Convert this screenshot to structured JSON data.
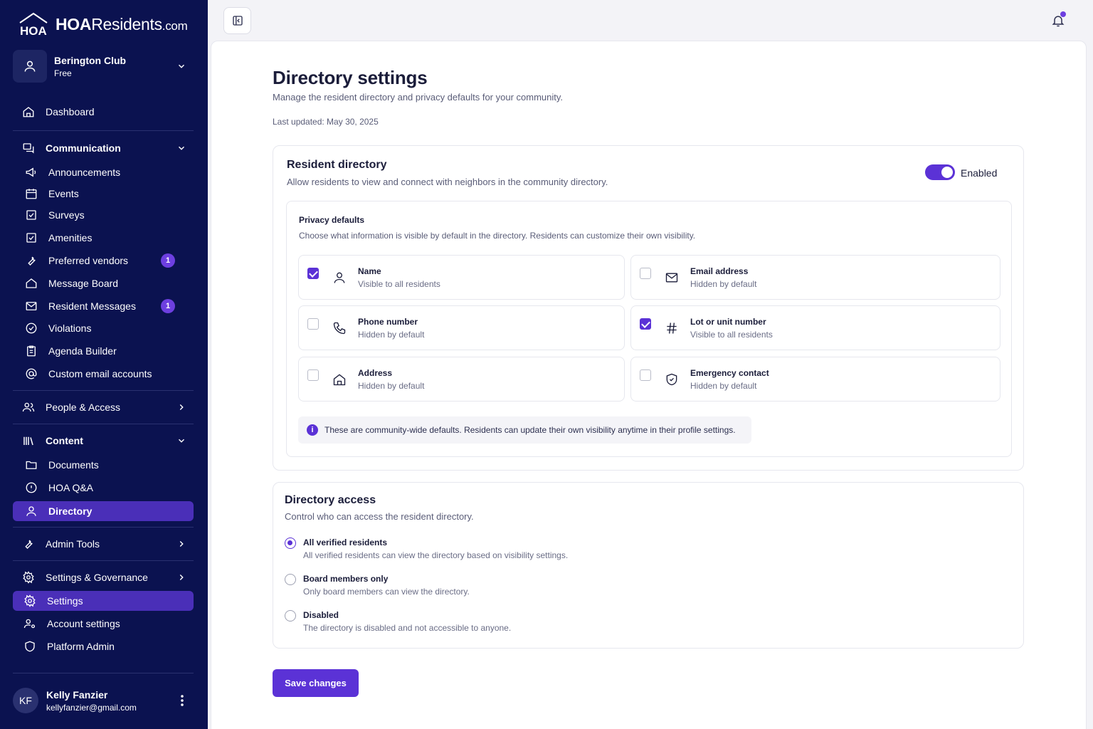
{
  "brand": {
    "logo_mark": "HOA",
    "logo_bold": "HOA",
    "logo_rest": "Residents",
    "logo_suffix": ".com"
  },
  "org": {
    "name": "Berington Club",
    "plan": "Free"
  },
  "nav": {
    "dashboard": "Dashboard",
    "communication": "Communication",
    "announcements": "Announcements",
    "events": "Events",
    "surveys": "Surveys",
    "amenities": "Amenities",
    "preferred_vendors": "Preferred vendors",
    "preferred_vendors_badge": "1",
    "message_board": "Message Board",
    "resident_messages": "Resident Messages",
    "resident_messages_badge": "1",
    "violations": "Violations",
    "agenda_builder": "Agenda Builder",
    "custom_email": "Custom email accounts",
    "people_access": "People & Access",
    "content": "Content",
    "documents": "Documents",
    "hoa_qa": "HOA Q&A",
    "directory": "Directory",
    "admin_tools": "Admin Tools",
    "settings_governance": "Settings & Governance",
    "settings": "Settings",
    "account_settings": "Account settings",
    "platform_admin": "Platform Admin"
  },
  "user": {
    "initials": "KF",
    "name": "Kelly Fanzier",
    "email": "kellyfanzier@gmail.com"
  },
  "page": {
    "title": "Directory settings",
    "subtitle": "Manage the resident directory and privacy defaults for your community.",
    "updated": "Last updated: May 30, 2025"
  },
  "resident_directory": {
    "title": "Resident directory",
    "description": "Allow residents to view and connect with neighbors in the community directory.",
    "toggle_label": "Enabled",
    "privacy_title": "Privacy defaults",
    "privacy_desc": "Choose what information is visible by default in the directory. Residents can customize their own visibility.",
    "options": [
      {
        "title": "Name",
        "status": "Visible to all residents",
        "checked": true
      },
      {
        "title": "Email address",
        "status": "Hidden by default",
        "checked": false
      },
      {
        "title": "Phone number",
        "status": "Hidden by default",
        "checked": false
      },
      {
        "title": "Lot or unit number",
        "status": "Visible to all residents",
        "checked": true
      },
      {
        "title": "Address",
        "status": "Hidden by default",
        "checked": false
      },
      {
        "title": "Emergency contact",
        "status": "Hidden by default",
        "checked": false
      }
    ],
    "info_text": "These are community-wide defaults. Residents can update their own visibility anytime in their profile settings."
  },
  "directory_access": {
    "title": "Directory access",
    "description": "Control who can access the resident directory.",
    "options": [
      {
        "title": "All verified residents",
        "desc": "All verified residents can view the directory based on visibility settings.",
        "selected": true
      },
      {
        "title": "Board members only",
        "desc": "Only board members can view the directory.",
        "selected": false
      },
      {
        "title": "Disabled",
        "desc": "The directory is disabled and not accessible to anyone.",
        "selected": false
      }
    ]
  },
  "actions": {
    "save": "Save changes"
  },
  "colors": {
    "sidebar": "#0b1250",
    "accent": "#5b32d6",
    "active_nav": "#4a2fb8"
  }
}
